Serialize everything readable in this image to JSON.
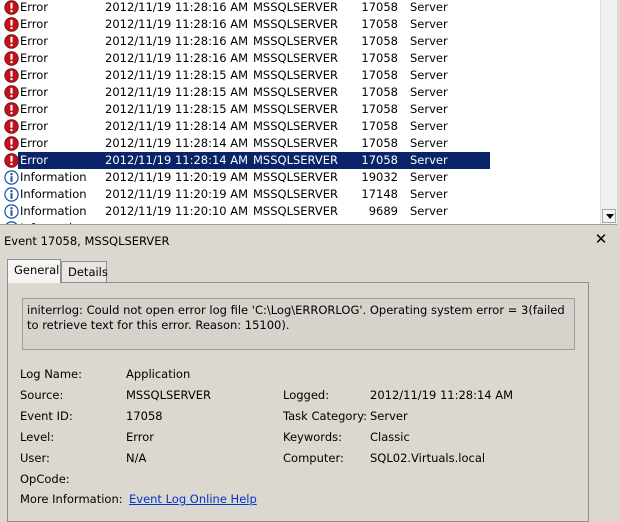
{
  "events": [
    {
      "level": "Error",
      "icon": "error",
      "date": "2012/11/19 11:28:16 AM",
      "source": "MSSQLSERVER",
      "id": "17058",
      "category": "Server"
    },
    {
      "level": "Error",
      "icon": "error",
      "date": "2012/11/19 11:28:16 AM",
      "source": "MSSQLSERVER",
      "id": "17058",
      "category": "Server"
    },
    {
      "level": "Error",
      "icon": "error",
      "date": "2012/11/19 11:28:16 AM",
      "source": "MSSQLSERVER",
      "id": "17058",
      "category": "Server"
    },
    {
      "level": "Error",
      "icon": "error",
      "date": "2012/11/19 11:28:16 AM",
      "source": "MSSQLSERVER",
      "id": "17058",
      "category": "Server"
    },
    {
      "level": "Error",
      "icon": "error",
      "date": "2012/11/19 11:28:15 AM",
      "source": "MSSQLSERVER",
      "id": "17058",
      "category": "Server"
    },
    {
      "level": "Error",
      "icon": "error",
      "date": "2012/11/19 11:28:15 AM",
      "source": "MSSQLSERVER",
      "id": "17058",
      "category": "Server"
    },
    {
      "level": "Error",
      "icon": "error",
      "date": "2012/11/19 11:28:15 AM",
      "source": "MSSQLSERVER",
      "id": "17058",
      "category": "Server"
    },
    {
      "level": "Error",
      "icon": "error",
      "date": "2012/11/19 11:28:14 AM",
      "source": "MSSQLSERVER",
      "id": "17058",
      "category": "Server"
    },
    {
      "level": "Error",
      "icon": "error",
      "date": "2012/11/19 11:28:14 AM",
      "source": "MSSQLSERVER",
      "id": "17058",
      "category": "Server"
    },
    {
      "level": "Error",
      "icon": "error",
      "date": "2012/11/19 11:28:14 AM",
      "source": "MSSQLSERVER",
      "id": "17058",
      "category": "Server",
      "selected": true
    },
    {
      "level": "Information",
      "icon": "info",
      "date": "2012/11/19 11:20:19 AM",
      "source": "MSSQLSERVER",
      "id": "19032",
      "category": "Server"
    },
    {
      "level": "Information",
      "icon": "info",
      "date": "2012/11/19 11:20:19 AM",
      "source": "MSSQLSERVER",
      "id": "17148",
      "category": "Server"
    },
    {
      "level": "Information",
      "icon": "info",
      "date": "2012/11/19 11:20:10 AM",
      "source": "MSSQLSERVER",
      "id": "9689",
      "category": "Server"
    },
    {
      "level": "Information",
      "icon": "info",
      "date": "",
      "source": "",
      "id": "",
      "category": ""
    }
  ],
  "details": {
    "title": "Event 17058, MSSQLSERVER",
    "tabs": {
      "general": "General",
      "details": "Details"
    },
    "message": "initerrlog: Could not open error log file 'C:\\Log\\ERRORLOG'. Operating system error = 3(failed to retrieve text for this error. Reason: 15100).",
    "log_name_label": "Log Name:",
    "log_name": "Application",
    "source_label": "Source:",
    "source": "MSSQLSERVER",
    "event_id_label": "Event ID:",
    "event_id": "17058",
    "level_label": "Level:",
    "level": "Error",
    "user_label": "User:",
    "user": "N/A",
    "opcode_label": "OpCode:",
    "more_info_label": "More Information:",
    "more_info_link": "Event Log Online Help",
    "logged_label": "Logged:",
    "logged": "2012/11/19 11:28:14 AM",
    "task_category_label": "Task Category:",
    "task_category": "Server",
    "keywords_label": "Keywords:",
    "keywords": "Classic",
    "computer_label": "Computer:",
    "computer": "SQL02.Virtuals.local"
  },
  "colors": {
    "error": "#c0121a",
    "info": "#1f4fa8",
    "selection": "#0a246a",
    "link": "#0033cc"
  }
}
